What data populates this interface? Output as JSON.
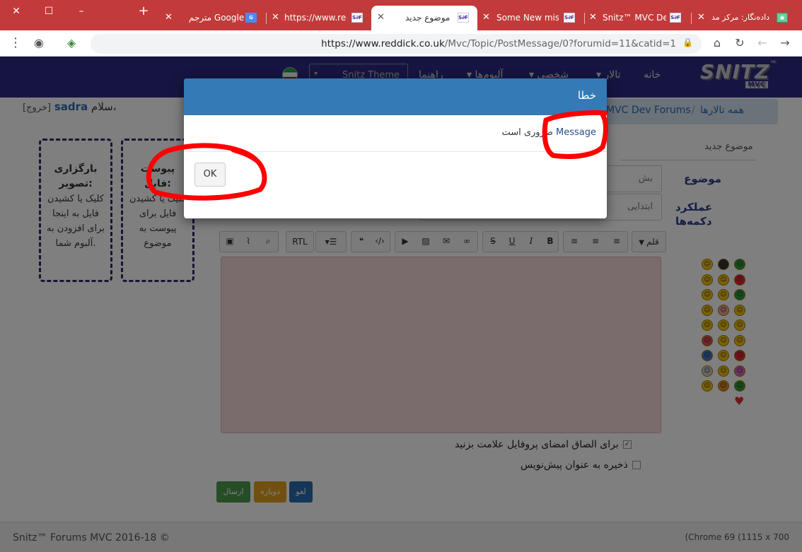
{
  "browser": {
    "tabs": [
      {
        "title": "دادەنگار: مرکز مد"
      },
      {
        "title": "Snitz™ MVC Dev"
      },
      {
        "title": "Some New miss"
      },
      {
        "title": "موضوع جدید"
      },
      {
        "title": "https://www.red"
      },
      {
        "title": "مترجم Google"
      }
    ],
    "favicon_text": "S∂F",
    "url": "https://www.reddick.co.uk/Mvc/Topic/PostMessage/0?forumid=11&catid=1",
    "url_host": "https://www.reddick.co.uk",
    "url_path": "/Mvc/Topic/PostMessage/0?forumid=11&catid=1"
  },
  "nav": {
    "logo_text": "SNITZ",
    "logo_sub": "MVC",
    "logo_tm": "™",
    "items": [
      {
        "label": "خانه"
      },
      {
        "label": "تالار"
      },
      {
        "label": "شخصی"
      },
      {
        "label": "آلبوم‌ها"
      },
      {
        "label": "راهنما"
      }
    ],
    "theme_label": "Snitz Theme"
  },
  "user": {
    "greeting": "سلام،",
    "name": "sadra",
    "logout": "[خروج]"
  },
  "breadcrumb": {
    "home": "همه تالارها",
    "separator": "/",
    "forum": "MVC Dev Forums"
  },
  "form": {
    "heading": "موضوع جدید",
    "subject_label": "موضوع",
    "subject_value": "بش",
    "buttons_label": "عملکرد دکمه‌ها",
    "buttons_value": "ابتدایی",
    "toolbar": {
      "font": "قلم",
      "rtl": "RTL",
      "bold": "B",
      "italic": "I",
      "underline": "U",
      "strike": "S"
    },
    "signature_check": "برای الصاق امضای پروفایل علامت بزنید",
    "draft_check": "ذخیره به عنوان پیش‌نویس",
    "cancel": "لغو",
    "reset": "دوباره",
    "submit": "ارسال"
  },
  "upload_image": {
    "title": "بارگزاری تصویر:",
    "text": "کلیک یا کشیدن فایل به اینجا برای افزودن به آلبوم شما."
  },
  "attach_file": {
    "title": "پیوست فایل:",
    "text": "کلیک یا کشیدن فایل برای پیوست به موضوع"
  },
  "footer": {
    "copyright": "Snitz™ Forums MVC 2016-18 ©",
    "browser_info": "(Chrome 69 (1115 x 700"
  },
  "modal": {
    "title": "خطا",
    "field": "Message",
    "message": "ضروری است",
    "ok": "OK"
  },
  "colors": {
    "tabstrip": "#c23a3a",
    "navbar": "#2d2a84",
    "modal_header": "#337ab7",
    "annotation": "#ff0000"
  }
}
